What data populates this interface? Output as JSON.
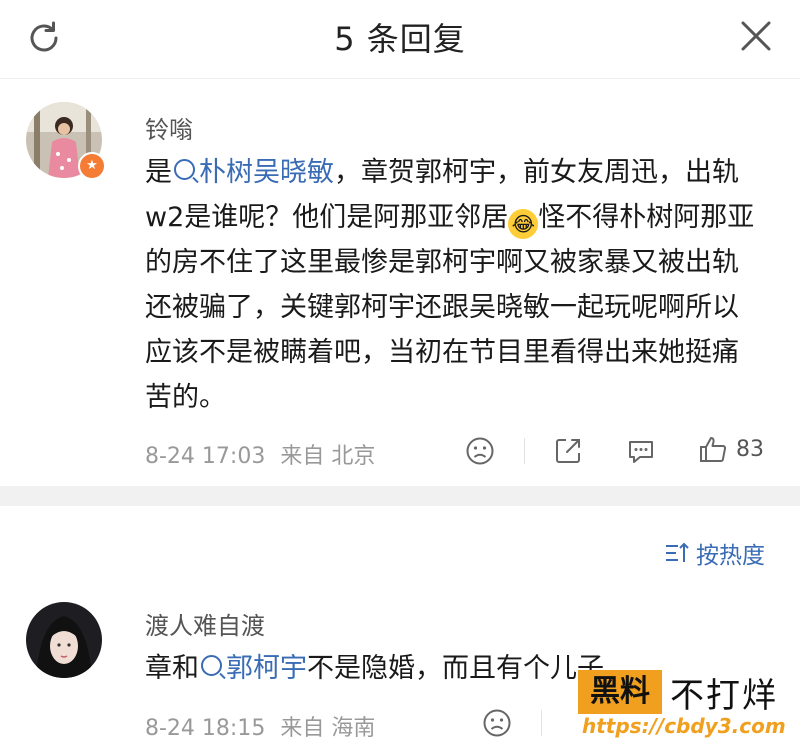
{
  "header": {
    "title": "5 条回复",
    "refresh_icon": "refresh-icon",
    "close_icon": "close-icon"
  },
  "comments": [
    {
      "username": "铃嗡",
      "content": {
        "prefix": "是",
        "mention": "朴树吴晓敏",
        "middle": "，章贺郭柯宇，前女友周迅，出轨w2是谁呢？他们是阿那亚邻居",
        "emoji": "😂",
        "suffix": "怪不得朴树阿那亚的房不住了这里最惨是郭柯宇啊又被家暴又被出轨还被骗了，关键郭柯宇还跟吴晓敏一起玩呢啊所以应该不是被瞒着吧，当初在节目里看得出来她挺痛苦的。"
      },
      "time": "8-24 17:03",
      "location": "来自 北京",
      "likes": "83"
    },
    {
      "username": "渡人难自渡",
      "content": {
        "prefix": "章和",
        "mention": "郭柯宇",
        "middle": "不是隐婚，而且有",
        "cut": "个儿子"
      },
      "time": "8-24 18:15",
      "location": "来自 海南"
    }
  ],
  "sort": {
    "label": "按热度"
  },
  "watermark": {
    "box": "黑料",
    "text": "不打烊",
    "url": "https://cbdy3.com"
  },
  "colors": {
    "accent": "#3a6cb5",
    "watermark": "#f0a01e"
  }
}
